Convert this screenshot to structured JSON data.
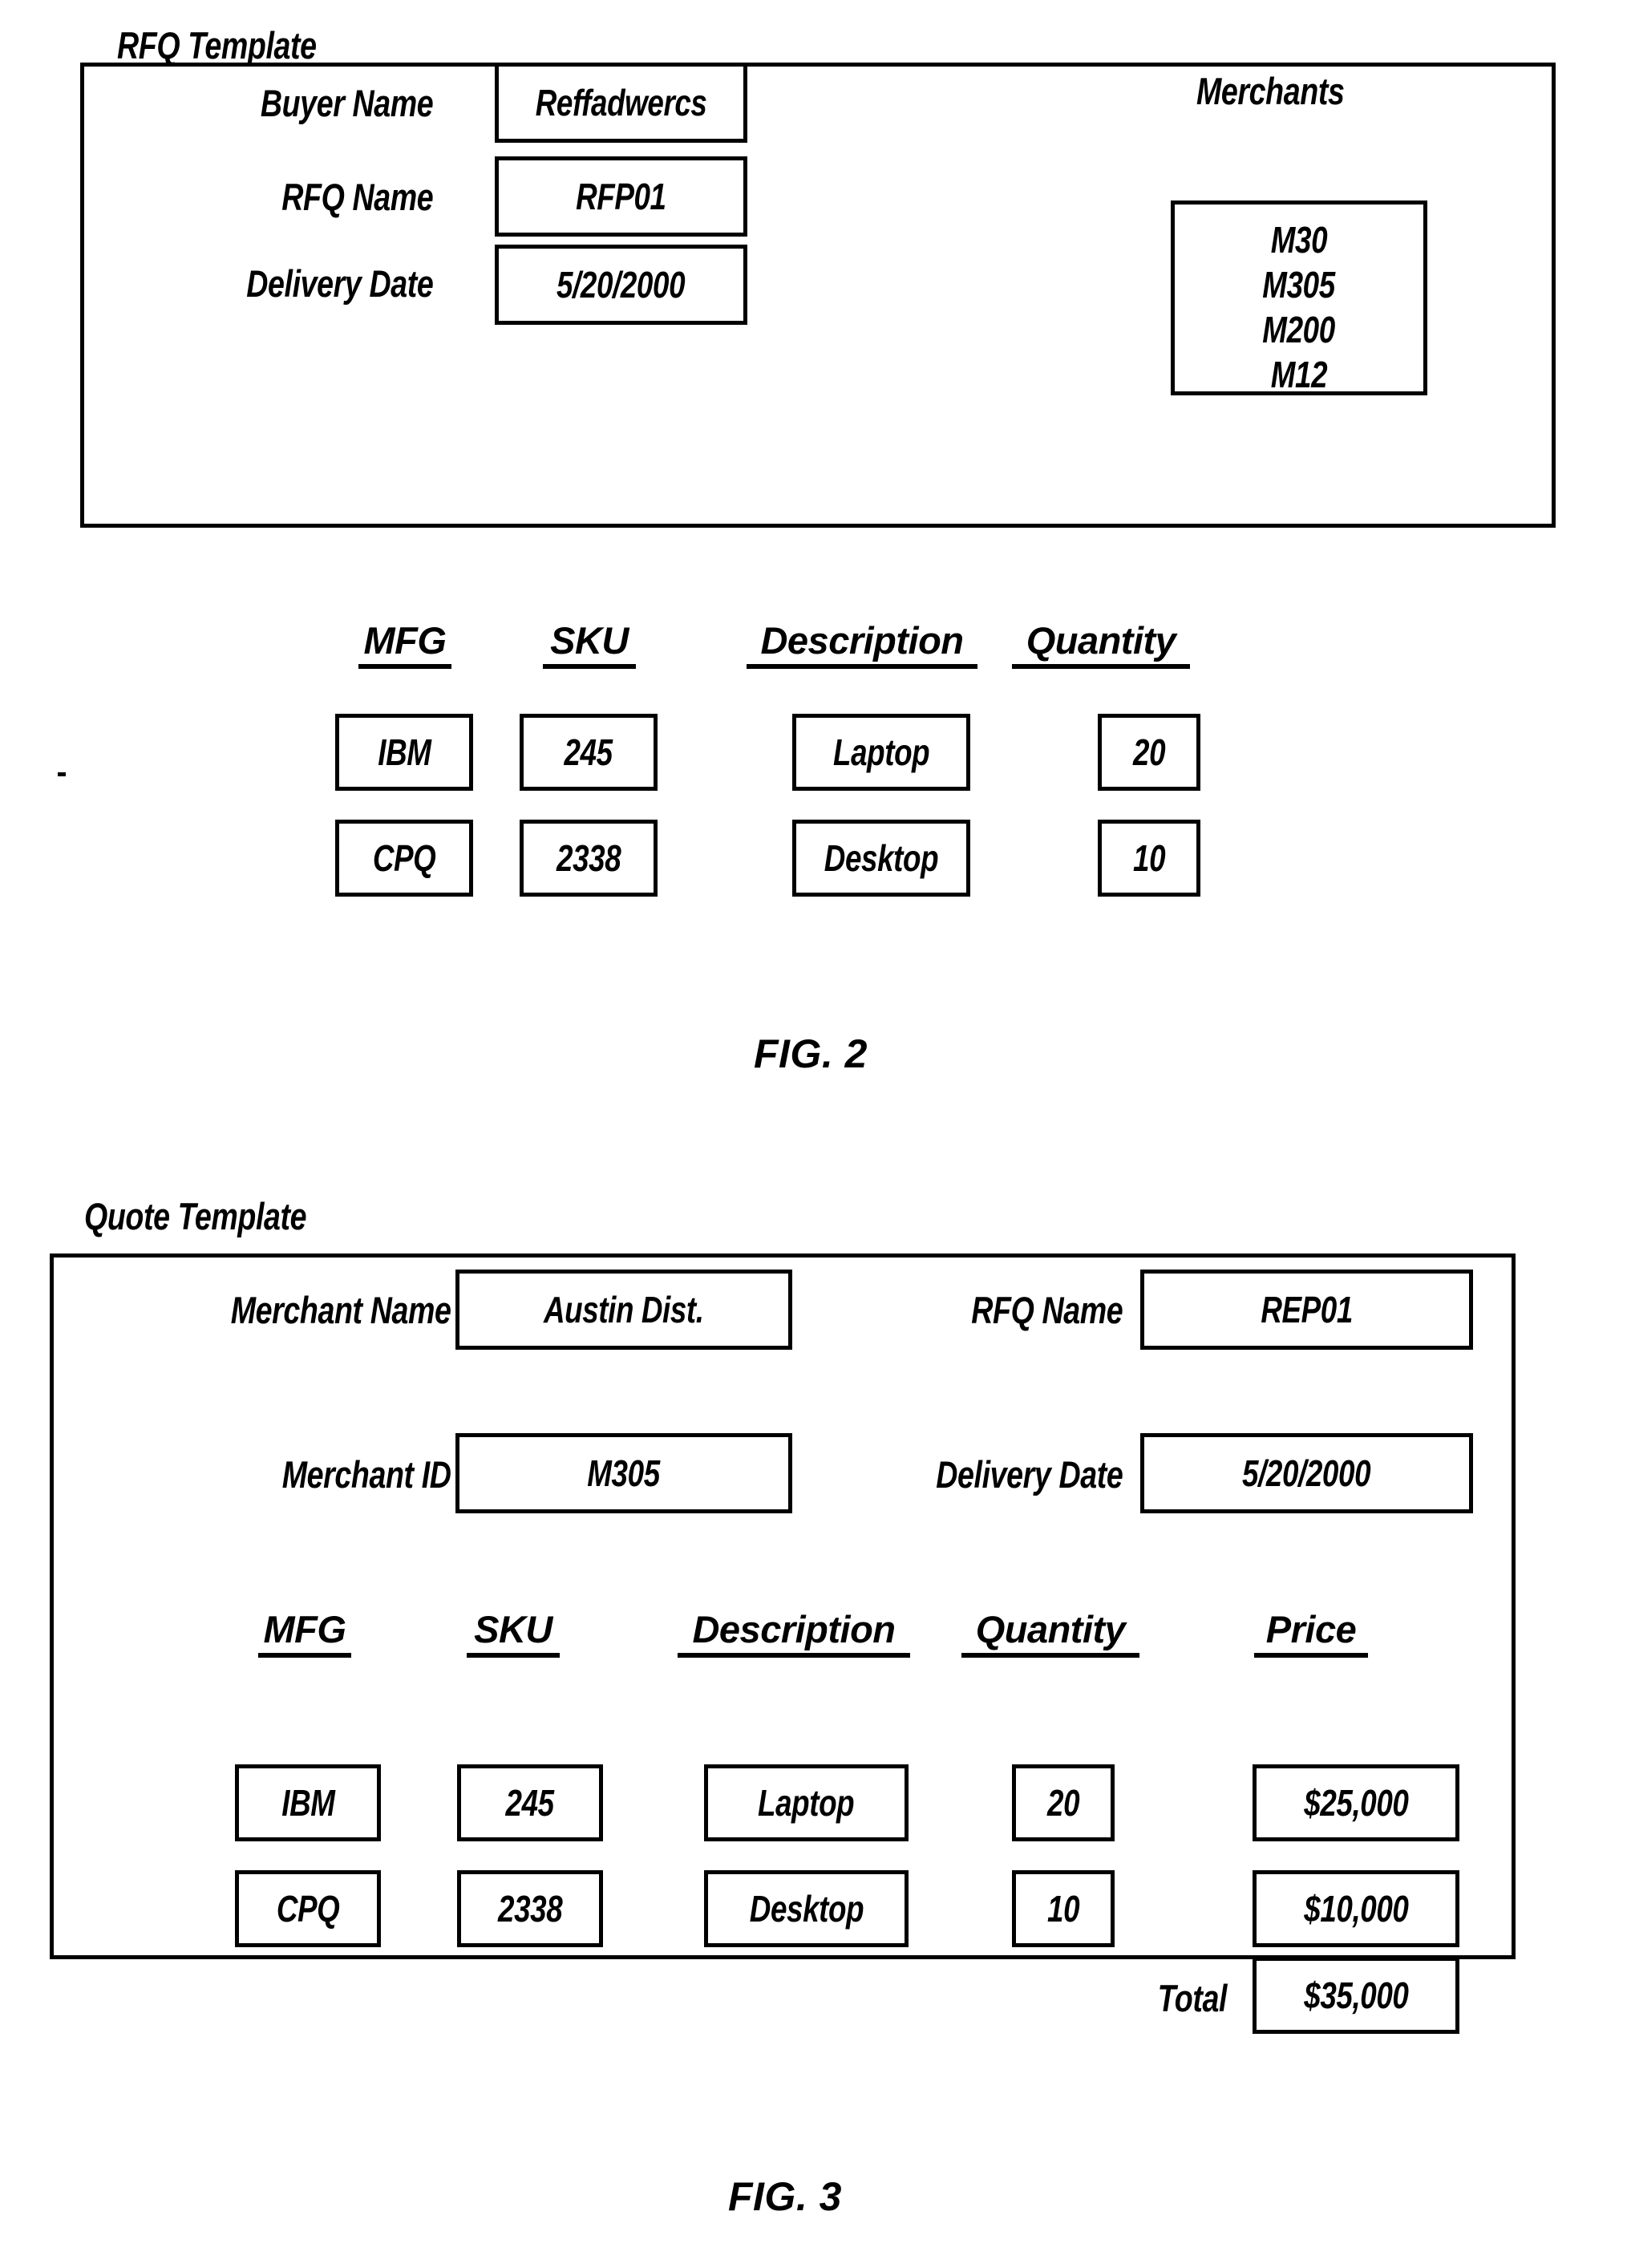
{
  "figures": [
    {
      "caption": "FIG. 2",
      "title": "RFQ Template",
      "fields": [
        {
          "label": "Buyer Name",
          "value": "Reffadwercs"
        },
        {
          "label": "RFQ Name",
          "value": "RFP01"
        },
        {
          "label": "Delivery Date",
          "value": "5/20/2000"
        }
      ],
      "merchants_panel": {
        "title": "Merchants",
        "items": [
          "M30",
          "M305",
          "M200",
          "M12"
        ]
      },
      "table": {
        "columns": [
          "MFG",
          "SKU",
          "Description",
          "Quantity"
        ],
        "rows": [
          [
            "IBM",
            "245",
            "Laptop",
            "20"
          ],
          [
            "CPQ",
            "2338",
            "Desktop",
            "10"
          ]
        ]
      }
    },
    {
      "caption": "FIG. 3",
      "title": "Quote Template",
      "fields": [
        {
          "label": "Merchant Name",
          "value": "Austin Dist."
        },
        {
          "label": "RFQ Name",
          "value": "REP01"
        },
        {
          "label": "Merchant ID",
          "value": "M305"
        },
        {
          "label": "Delivery Date",
          "value": "5/20/2000"
        }
      ],
      "table": {
        "columns": [
          "MFG",
          "SKU",
          "Description",
          "Quantity",
          "Price"
        ],
        "rows": [
          [
            "IBM",
            "245",
            "Laptop",
            "20",
            "$25,000"
          ],
          [
            "CPQ",
            "2338",
            "Desktop",
            "10",
            "$10,000"
          ]
        ],
        "total": {
          "label": "Total",
          "value": "$35,000"
        }
      }
    }
  ],
  "colors": {
    "ink": "#000000",
    "paper": "#ffffff"
  }
}
